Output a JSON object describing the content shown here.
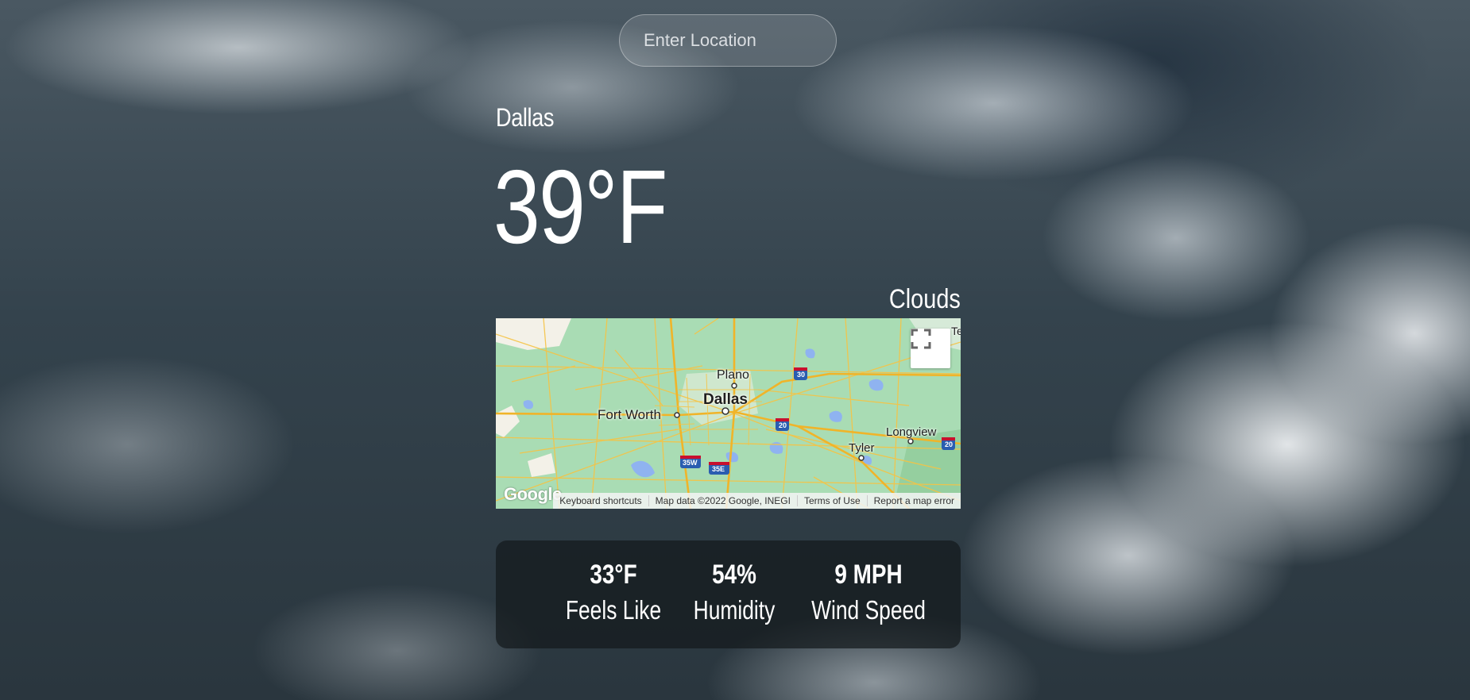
{
  "search": {
    "placeholder": "Enter Location"
  },
  "weather": {
    "city": "Dallas",
    "temperature": "39°F",
    "description": "Clouds"
  },
  "map": {
    "labels": {
      "plano": "Plano",
      "dallas": "Dallas",
      "fort_worth": "Fort Worth",
      "longview": "Longview",
      "tyler": "Tyler",
      "shield_30": "30",
      "shield_20": "20",
      "shield_20b": "20",
      "shield_35w": "35W",
      "shield_35e": "35E",
      "edge_fragment": "Te"
    },
    "logo": "Google",
    "attribution": {
      "shortcuts": "Keyboard shortcuts",
      "data": "Map data ©2022 Google, INEGI",
      "terms": "Terms of Use",
      "report": "Report a map error"
    },
    "colors": {
      "land": "#a9dcb4",
      "roads": "#f6c344",
      "water": "#8fb3f0"
    }
  },
  "stats": {
    "feels_like": {
      "value": "33°F",
      "label": "Feels Like"
    },
    "humidity": {
      "value": "54%",
      "label": "Humidity"
    },
    "wind": {
      "value": "9 MPH",
      "label": "Wind Speed"
    }
  }
}
